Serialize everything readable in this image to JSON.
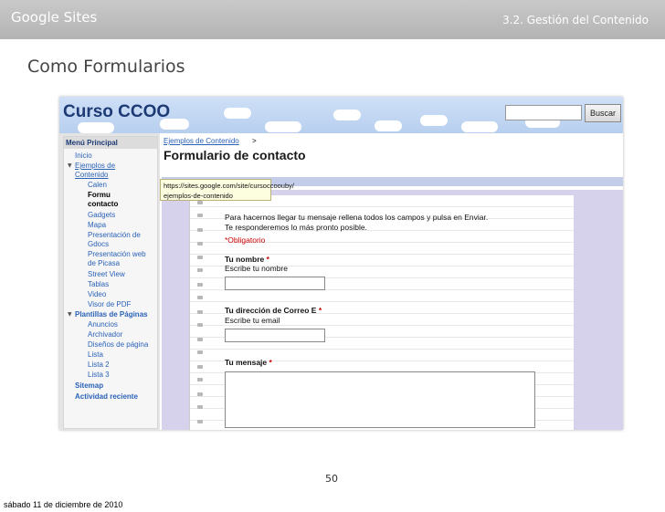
{
  "slide": {
    "header_left": "Google Sites",
    "header_right": "3.2. Gestión del Contenido",
    "title": "Como Formularios",
    "page_number": "50",
    "footer_date": "sábado 11 de diciembre de 2010"
  },
  "site": {
    "title": "Curso CCOO",
    "search_button": "Buscar",
    "search_value": ""
  },
  "sidebar": {
    "header": "Menú Principal",
    "items": [
      {
        "label": "Inicio"
      },
      {
        "label": "Ejemplos de"
      },
      {
        "label": "Contenido"
      },
      {
        "label": "Calen"
      },
      {
        "label": "Formu"
      },
      {
        "label": "contacto"
      },
      {
        "label": "Gadgets"
      },
      {
        "label": "Mapa"
      },
      {
        "label": "Presentación de"
      },
      {
        "label": "Gdocs"
      },
      {
        "label": "Presentación web"
      },
      {
        "label": "de Picasa"
      },
      {
        "label": "Street View"
      },
      {
        "label": "Tablas"
      },
      {
        "label": "Video"
      },
      {
        "label": "Visor de PDF"
      },
      {
        "label": "Plantillas de Páginas"
      },
      {
        "label": "Anuncios"
      },
      {
        "label": "Archivador"
      },
      {
        "label": "Diseños de página"
      },
      {
        "label": "Lista"
      },
      {
        "label": "Lista 2"
      },
      {
        "label": "Lista 3"
      },
      {
        "label": "Sitemap"
      },
      {
        "label": "Actividad reciente"
      }
    ]
  },
  "main": {
    "breadcrumb": "Ejemplos de Contenido",
    "breadcrumb_sep": ">",
    "page_title": "Formulario de contacto",
    "tooltip_line1": "https://sites.google.com/site/cursoccoouby/",
    "tooltip_line2": "ejemplos-de-contenido"
  },
  "form": {
    "intro_line1": "Para hacernos llegar tu mensaje rellena todos los campos y pulsa en Enviar.",
    "intro_line2": "Te responderemos lo más pronto posible.",
    "required_note": "*Obligatorio",
    "fields": [
      {
        "label": "Tu nombre",
        "required_mark": "*",
        "help": "Escribe tu nombre",
        "value": ""
      },
      {
        "label": "Tu dirección de Correo E",
        "required_mark": "*",
        "help": "Escribe tu email",
        "value": ""
      },
      {
        "label": "Tu mensaje",
        "required_mark": "*",
        "help": "",
        "value": ""
      }
    ]
  }
}
